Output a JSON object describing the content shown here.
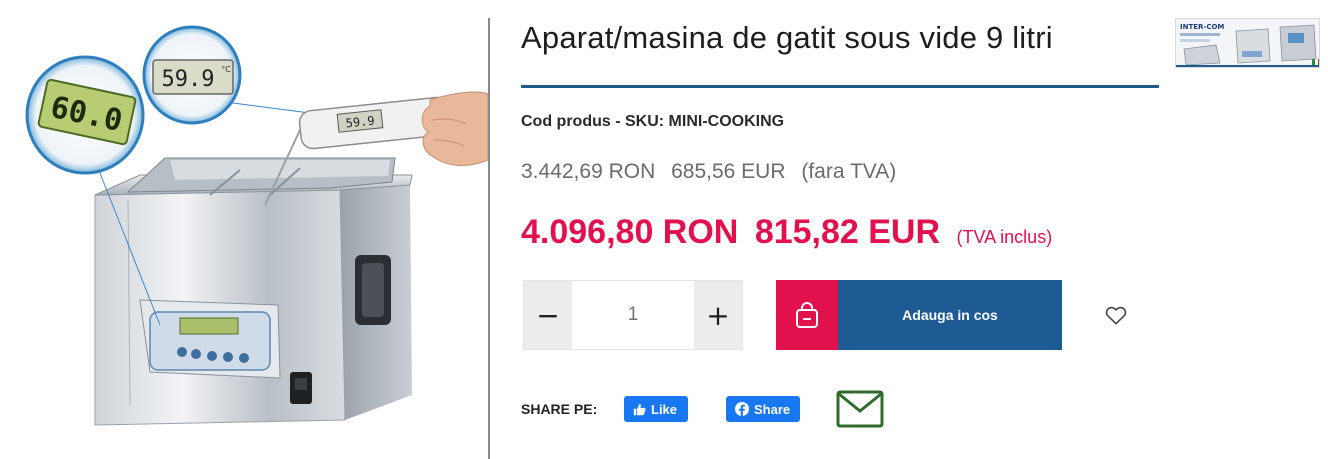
{
  "product": {
    "title": "Aparat/masina de gatit sous vide 9 litri",
    "sku_label": "Cod produs - SKU:",
    "sku_value": "MINI-COOKING",
    "image_alt": "sous-vide-water-bath",
    "display_temp_large": "60.0",
    "display_temp_small": "59.9",
    "display_temp_unit": "°C",
    "thermometer_readout": "59.9"
  },
  "pricing": {
    "net_ron": "3.442,69 RON",
    "net_eur": "685,56 EUR",
    "net_note": "(fara TVA)",
    "gross_ron": "4.096,80 RON",
    "gross_eur": "815,82 EUR",
    "gross_note": "(TVA inclus)",
    "accent_color": "#e0114d"
  },
  "cart": {
    "minus_label": "−",
    "plus_label": "+",
    "quantity_placeholder": "1",
    "add_label": "Adauga in cos",
    "cart_icon": "shopping-bag-icon",
    "wishlist_icon": "heart-icon",
    "button_color": "#1e5a94"
  },
  "share": {
    "label": "SHARE PE:",
    "like_label": "Like",
    "share_label": "Share",
    "email_icon": "envelope-icon"
  },
  "thumbnail": {
    "brand_text": "INTER-COM"
  }
}
